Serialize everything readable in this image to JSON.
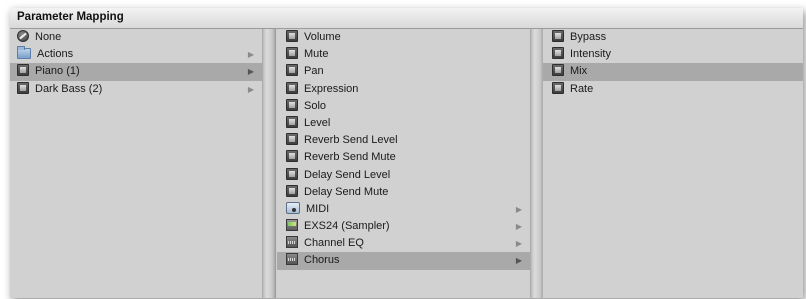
{
  "window": {
    "title": "Parameter Mapping"
  },
  "column1": {
    "items": [
      {
        "label": "None",
        "icon": "none-icon",
        "selected": false,
        "has_submenu": false
      },
      {
        "label": "Actions",
        "icon": "folder-icon",
        "selected": false,
        "has_submenu": true
      },
      {
        "label": "Piano (1)",
        "icon": "plugin-icon",
        "selected": true,
        "has_submenu": true
      },
      {
        "label": "Dark Bass (2)",
        "icon": "plugin-icon",
        "selected": false,
        "has_submenu": true
      }
    ]
  },
  "column2": {
    "items": [
      {
        "label": "Volume",
        "icon": "plugin-icon",
        "selected": false,
        "has_submenu": false
      },
      {
        "label": "Mute",
        "icon": "plugin-icon",
        "selected": false,
        "has_submenu": false
      },
      {
        "label": "Pan",
        "icon": "plugin-icon",
        "selected": false,
        "has_submenu": false
      },
      {
        "label": "Expression",
        "icon": "plugin-icon",
        "selected": false,
        "has_submenu": false
      },
      {
        "label": "Solo",
        "icon": "plugin-icon",
        "selected": false,
        "has_submenu": false
      },
      {
        "label": "Level",
        "icon": "plugin-icon",
        "selected": false,
        "has_submenu": false
      },
      {
        "label": "Reverb Send Level",
        "icon": "plugin-icon",
        "selected": false,
        "has_submenu": false
      },
      {
        "label": "Reverb Send Mute",
        "icon": "plugin-icon",
        "selected": false,
        "has_submenu": false
      },
      {
        "label": "Delay Send Level",
        "icon": "plugin-icon",
        "selected": false,
        "has_submenu": false
      },
      {
        "label": "Delay Send Mute",
        "icon": "plugin-icon",
        "selected": false,
        "has_submenu": false
      },
      {
        "label": "MIDI",
        "icon": "midi-icon",
        "selected": false,
        "has_submenu": true
      },
      {
        "label": "EXS24  (Sampler)",
        "icon": "sampler-icon",
        "selected": false,
        "has_submenu": true
      },
      {
        "label": "Channel EQ",
        "icon": "eq-icon",
        "selected": false,
        "has_submenu": true
      },
      {
        "label": "Chorus",
        "icon": "eq-icon",
        "selected": true,
        "has_submenu": true
      }
    ]
  },
  "column3": {
    "items": [
      {
        "label": "Bypass",
        "icon": "plugin-icon",
        "selected": false,
        "has_submenu": false
      },
      {
        "label": "Intensity",
        "icon": "plugin-icon",
        "selected": false,
        "has_submenu": false
      },
      {
        "label": "Mix",
        "icon": "plugin-icon",
        "selected": true,
        "has_submenu": false
      },
      {
        "label": "Rate",
        "icon": "plugin-icon",
        "selected": false,
        "has_submenu": false
      }
    ]
  },
  "submenu_arrow": "▶"
}
